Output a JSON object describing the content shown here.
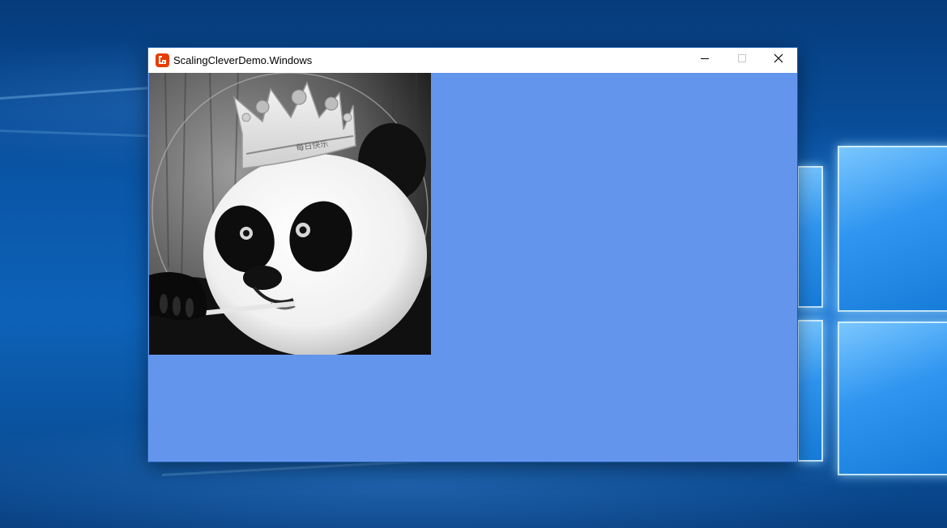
{
  "desktop": {
    "os": "Windows 10",
    "logo_icon": "windows-logo-icon"
  },
  "window": {
    "title": "ScalingCleverDemo.Windows",
    "app_icon": "monogame-icon",
    "controls": {
      "minimize_icon": "minimize-icon",
      "maximize_icon": "maximize-icon",
      "close_icon": "close-icon"
    },
    "client_background": "#6495ED",
    "sprite": {
      "subject": "panda-with-crown-image",
      "crown_text": "每日快乐"
    }
  },
  "colors": {
    "cornflower_blue": "#6495ED",
    "monogame_orange": "#E73C00",
    "titlebar": "#FFFFFF"
  }
}
